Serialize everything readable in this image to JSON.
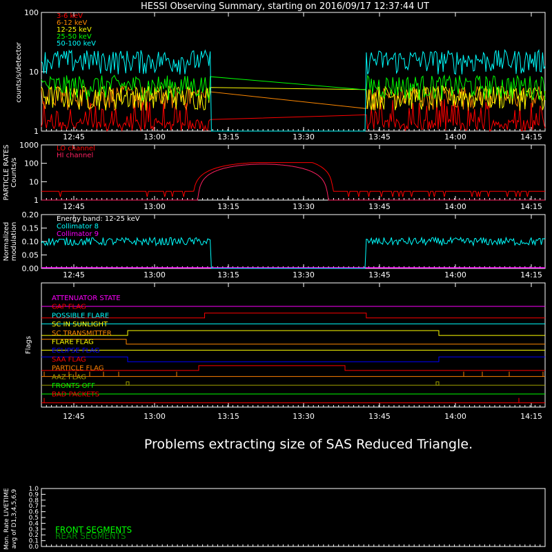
{
  "title": "HESSI Observing Summary, starting on 2016/09/17 12:37:44 UT",
  "time_ticks": [
    "12:45",
    "13:00",
    "13:15",
    "13:30",
    "13:45",
    "14:00",
    "14:15"
  ],
  "message": "Problems extracting size of SAS Reduced Triangle.",
  "colors": {
    "bg": "#000000",
    "axis": "#ffffff",
    "red": "#ff0000",
    "orange": "#ff8800",
    "yellow": "#ffff00",
    "green": "#00ff00",
    "cyan": "#00ffff",
    "magenta": "#ff00ff",
    "crimson": "#ff2060",
    "blue": "#0000ff",
    "olive": "#a0a000",
    "darkorange": "#ff8000",
    "darkgreen": "#008800"
  },
  "chart_data": [
    {
      "type": "line",
      "name": "count-rates",
      "ylabel": "counts/s/detector",
      "yscale": "log",
      "ylim": [
        1,
        100
      ],
      "y_ticks": [
        "1",
        "10",
        "100"
      ],
      "x_range_minutes": [
        0,
        100
      ],
      "gap_minutes": [
        33.5,
        64.5
      ],
      "series": [
        {
          "name": "3-6 keV",
          "color": "red",
          "level": 1.6
        },
        {
          "name": "6-12 keV",
          "color": "orange",
          "level": 4
        },
        {
          "name": "12-25 keV",
          "color": "yellow",
          "level": 4
        },
        {
          "name": "25-50 keV",
          "color": "green",
          "level": 6
        },
        {
          "name": "50-100 keV",
          "color": "cyan",
          "level": 16
        }
      ]
    },
    {
      "type": "line",
      "name": "particle-rates",
      "ylabel": "PARTICLE RATES\nCounts/s",
      "yscale": "log",
      "ylim": [
        1,
        1000
      ],
      "y_ticks": [
        "1",
        "10",
        "100",
        "1000"
      ],
      "series": [
        {
          "name": "LO channel",
          "color": "red"
        },
        {
          "name": "HI channel",
          "color": "crimson"
        }
      ]
    },
    {
      "type": "line",
      "name": "modulation",
      "ylabel": "Normalized\nmodulation",
      "ylim": [
        0,
        0.2
      ],
      "y_ticks": [
        "0.00",
        "0.05",
        "0.10",
        "0.15",
        "0.20"
      ],
      "annotation": "Energy band: 12-25 keV",
      "series": [
        {
          "name": "Collimator 8",
          "color": "cyan",
          "level": 0.1
        },
        {
          "name": "Collimator 9",
          "color": "magenta",
          "level": 0.0
        }
      ]
    },
    {
      "type": "line",
      "name": "flags",
      "ylabel": "Flags",
      "series": [
        {
          "name": "ATTENUATOR STATE",
          "color": "magenta"
        },
        {
          "name": "GAP FLAG",
          "color": "red"
        },
        {
          "name": "POSSIBLE FLARE",
          "color": "cyan"
        },
        {
          "name": "SC IN SUNLIGHT",
          "color": "yellow"
        },
        {
          "name": "SC TRANSMITTER",
          "color": "orange"
        },
        {
          "name": "FLARE FLAG",
          "color": "yellow"
        },
        {
          "name": "ECLIPSE FLAG",
          "color": "blue"
        },
        {
          "name": "SAA FLAG",
          "color": "red"
        },
        {
          "name": "PARTICLE FLAG",
          "color": "darkorange"
        },
        {
          "name": "AAZ FLAG",
          "color": "olive"
        },
        {
          "name": "FRONTS OFF",
          "color": "green"
        },
        {
          "name": "BAD PACKETS",
          "color": "red"
        }
      ]
    },
    {
      "type": "line",
      "name": "livetime",
      "ylabel": "Mon. Rate LIVETIME\navg of D1,3,4,5,6,9",
      "ylim": [
        0,
        1
      ],
      "y_ticks": [
        "0.0",
        "0.1",
        "0.2",
        "0.3",
        "0.4",
        "0.5",
        "0.6",
        "0.7",
        "0.8",
        "0.9",
        "1.0"
      ],
      "series": [
        {
          "name": "FRONT SEGMENTS",
          "color": "green"
        },
        {
          "name": "REAR SEGMENTS",
          "color": "darkgreen"
        }
      ]
    }
  ]
}
